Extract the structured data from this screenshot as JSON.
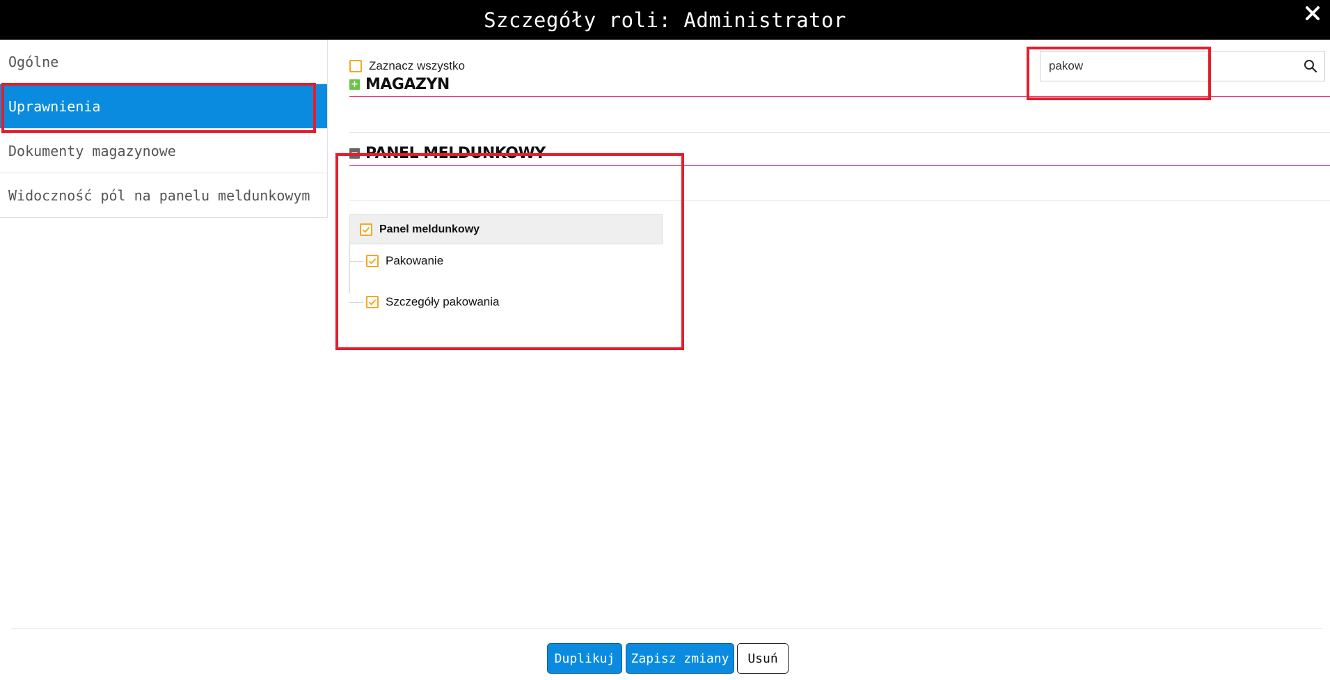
{
  "window": {
    "title": "Szczegóły roli: Administrator"
  },
  "sidebar": {
    "items": [
      {
        "label": "Ogólne"
      },
      {
        "label": "Uprawnienia"
      },
      {
        "label": "Dokumenty magazynowe"
      },
      {
        "label": "Widoczność pól na panelu meldunkowym"
      }
    ],
    "active_index": 1
  },
  "permissions": {
    "select_all_label": "Zaznacz wszystko",
    "search": {
      "value": "pakow"
    },
    "sections": [
      {
        "title": "MAGAZYN",
        "expanded": false,
        "toggle_symbol": "+"
      },
      {
        "title": "PANEL MELDUNKOWY",
        "expanded": true,
        "toggle_symbol": "−"
      }
    ],
    "tree": {
      "parent": {
        "label": "Panel meldunkowy",
        "checked": true
      },
      "children": [
        {
          "label": "Pakowanie",
          "checked": true
        },
        {
          "label": "Szczegóły pakowania",
          "checked": true
        }
      ]
    }
  },
  "footer": {
    "duplicate_label": "Duplikuj",
    "save_label": "Zapisz zmiany",
    "delete_label": "Usuń"
  },
  "colors": {
    "accent": "#0a8be0",
    "highlight": "#e41e2b",
    "checkbox": "#f5a623",
    "section_rule": "#e8326b"
  }
}
